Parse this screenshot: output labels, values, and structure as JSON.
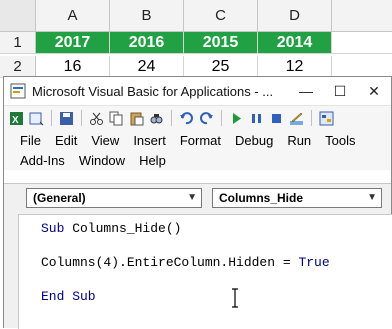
{
  "sheet": {
    "columns": [
      "A",
      "B",
      "C",
      "D"
    ],
    "rows": [
      {
        "num": "1",
        "cells": [
          "2017",
          "2016",
          "2015",
          "2014"
        ]
      },
      {
        "num": "2",
        "cells": [
          "16",
          "24",
          "25",
          "12"
        ]
      }
    ]
  },
  "window": {
    "title": "Microsoft Visual Basic for Applications - ...",
    "minimize": "—",
    "maximize": "☐",
    "close": "✕"
  },
  "menu": {
    "row1": [
      "File",
      "Edit",
      "View",
      "Insert",
      "Format",
      "Debug",
      "Run",
      "Tools"
    ],
    "row2": [
      "Add-Ins",
      "Window",
      "Help"
    ]
  },
  "editor": {
    "object_combo": "(General)",
    "proc_combo": "Columns_Hide",
    "line1_kw": "Sub",
    "line1_rest": " Columns_Hide()",
    "line2_pre": "Columns(4).EntireColumn.Hidden = ",
    "line2_kw": "True",
    "line3": "End Sub"
  },
  "colors": {
    "green": "#21a044",
    "keyword": "#00008b"
  }
}
